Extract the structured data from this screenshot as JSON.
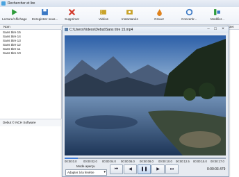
{
  "app": {
    "title": "Rechercher et lire"
  },
  "toolbar": [
    {
      "label": "Lecture/Affichage",
      "icon": "play-icon",
      "color": "#2e9b3a"
    },
    {
      "label": "Enregistrer sous...",
      "icon": "save-icon",
      "color": "#3a78c4"
    },
    {
      "label": "Supprimer",
      "icon": "delete-icon",
      "color": "#d23a2b"
    },
    {
      "label": "Vidéos",
      "icon": "video-icon",
      "color": "#c9a32a"
    },
    {
      "label": "Instantanés",
      "icon": "snapshot-icon",
      "color": "#c9a32a"
    },
    {
      "label": "Graver",
      "icon": "burn-icon",
      "color": "#e0821c"
    },
    {
      "label": "Convertir...",
      "icon": "convert-icon",
      "color": "#3a78c4"
    },
    {
      "label": "Modifier...",
      "icon": "edit-icon",
      "color": "#2e9b3a"
    }
  ],
  "list": {
    "column": "Nom",
    "right_column": "Det",
    "items": [
      "Sans titre 15",
      "Sans titre 14",
      "Sans titre 13",
      "Sans titre 12",
      "Sans titre 11",
      "Sans titre 10"
    ]
  },
  "status": "Debut © NCH Software",
  "player": {
    "title": "C:\\Users\\Videos\\Debut\\Sans titre 15.mp4",
    "progress": 0.08,
    "ticks": [
      "00:00:0.0",
      "00:00:02.0",
      "00:00:04.0",
      "00:00:06.0",
      "00:00:08.0",
      "00:00:10.0",
      "00:00:12.5",
      "00:00:15.0",
      "00:00:17.0"
    ],
    "mode_label": "Mode aperçu",
    "fit_value": "Adapter à la fenêtre",
    "time": "0:00:03.479"
  }
}
